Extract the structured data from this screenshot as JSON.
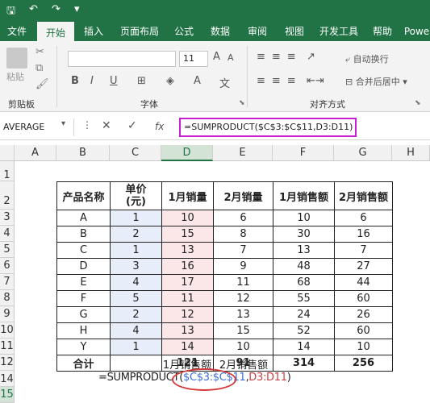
{
  "ribbon_tabs": [
    "文件",
    "开始",
    "插入",
    "页面布局",
    "公式",
    "数据",
    "审阅",
    "视图",
    "开发工具",
    "帮助",
    "Powe"
  ],
  "ribbon_active": "开始",
  "ribbon_groups": {
    "clipboard": "剪贴板",
    "paste": "粘贴",
    "font": "字体",
    "align": "对齐方式",
    "wrap": "自动换行",
    "merge": "合并后居中",
    "font_size": "11"
  },
  "formula_bar": {
    "name_box": "AVERAGE",
    "fx": "fx",
    "formula": "=SUMPRODUCT($C$3:$C$11,D3:D11)"
  },
  "columns": [
    "A",
    "B",
    "C",
    "D",
    "E",
    "F",
    "G",
    "H"
  ],
  "rows": [
    "1",
    "2",
    "3",
    "4",
    "5",
    "6",
    "7",
    "8",
    "9",
    "10",
    "11",
    "12",
    "14",
    "15"
  ],
  "table": {
    "headers": [
      "产品名称",
      "单价\n(元)",
      "1月销量",
      "2月销量",
      "1月销售额",
      "2月销售额"
    ],
    "rows": [
      [
        "A",
        "1",
        "10",
        "6",
        "10",
        "6"
      ],
      [
        "B",
        "2",
        "15",
        "8",
        "30",
        "16"
      ],
      [
        "C",
        "1",
        "13",
        "7",
        "13",
        "7"
      ],
      [
        "D",
        "3",
        "16",
        "9",
        "48",
        "27"
      ],
      [
        "E",
        "4",
        "17",
        "11",
        "68",
        "44"
      ],
      [
        "F",
        "5",
        "11",
        "12",
        "55",
        "60"
      ],
      [
        "G",
        "2",
        "12",
        "13",
        "24",
        "26"
      ],
      [
        "H",
        "4",
        "13",
        "15",
        "52",
        "60"
      ],
      [
        "Y",
        "1",
        "14",
        "10",
        "14",
        "10"
      ]
    ],
    "total": [
      "合计",
      "",
      "121",
      "91",
      "314",
      "256"
    ]
  },
  "row14": {
    "d": "1月销售额",
    "e": "2月销售额"
  },
  "row15": {
    "prefix": "=SUMPRODUCT(",
    "range1": "$C$3:$C$11",
    "sep": ",",
    "range2": "D3:D11",
    "suffix": ")"
  }
}
